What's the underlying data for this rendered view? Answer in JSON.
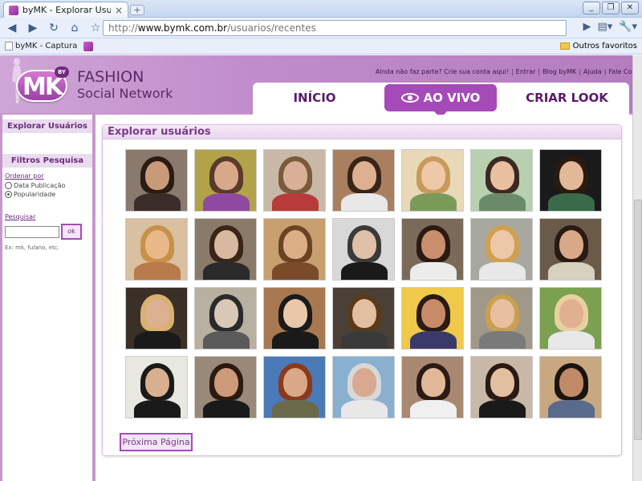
{
  "browser": {
    "tab_title": "byMK - Explorar Usuários",
    "tab_close": "×",
    "new_tab": "+",
    "window_buttons": [
      "_",
      "❐",
      "✕"
    ],
    "url_scheme": "http://",
    "url_host": "www.bymk.com.br",
    "url_path": "/usuarios/recentes",
    "bookmarks": [
      {
        "label": "byMK - Captura"
      }
    ],
    "other_bookmarks": "Outros favoritos"
  },
  "site": {
    "logo_text": "MK",
    "logo_badge": "BY",
    "brand_line1": "FASHION",
    "brand_line2": "Social Network",
    "top_links": [
      "Ainda não faz parte? Crie sua conta aqui!",
      "Entrar",
      "Blog byMK",
      "Ajuda",
      "Fale Conosco"
    ],
    "nav": [
      {
        "label": "INÍCIO",
        "active": false
      },
      {
        "label": "AO VIVO",
        "active": true
      },
      {
        "label": "CRIAR LOOK",
        "active": false
      }
    ]
  },
  "sidebar": {
    "explore_title": "Explorar Usuários",
    "filters_title": "Filtros Pesquisa",
    "order_label": "Ordenar por",
    "order_options": [
      {
        "label": "Data Publicação",
        "checked": false
      },
      {
        "label": "Popularidade",
        "checked": true
      }
    ],
    "search_label": "Pesquisar",
    "search_value": "",
    "search_button": "ok",
    "search_hint": "Ex: mk, fulano, etc."
  },
  "main": {
    "title": "Explorar usuários",
    "next_button": "Próxima Página",
    "users": [
      {
        "bg": "#8a7a6e",
        "skin": "#c99a7a",
        "hair": "#2a1b14",
        "body": "#3a2c28"
      },
      {
        "bg": "#b2a24a",
        "skin": "#d8a88a",
        "hair": "#5a3a2a",
        "body": "#8e4aa0"
      },
      {
        "bg": "#c8b8a8",
        "skin": "#d8b098",
        "hair": "#7a5a3a",
        "body": "#b83a3a"
      },
      {
        "bg": "#a88060",
        "skin": "#dcb090",
        "hair": "#3a2418",
        "body": "#e8e8e8"
      },
      {
        "bg": "#e8d8b8",
        "skin": "#eec8a8",
        "hair": "#c89a5a",
        "body": "#7a9a5a"
      },
      {
        "bg": "#b8d0b0",
        "skin": "#e8c0a0",
        "hair": "#3a2a22",
        "body": "#6a8a6a"
      },
      {
        "bg": "#1a1a1a",
        "skin": "#e2b898",
        "hair": "#2a1a10",
        "body": "#3a6a4a"
      },
      {
        "bg": "#d8c0a0",
        "skin": "#e8b888",
        "hair": "#c89048",
        "body": "#b87a4a"
      },
      {
        "bg": "#8a7a6a",
        "skin": "#d8b8a0",
        "hair": "#3a2418",
        "body": "#2a2a2a"
      },
      {
        "bg": "#c8a070",
        "skin": "#dcae88",
        "hair": "#6a4422",
        "body": "#7a4a2a"
      },
      {
        "bg": "#d8d8d8",
        "skin": "#e0c0a8",
        "hair": "#3a3a3a",
        "body": "#1a1a1a"
      },
      {
        "bg": "#7a6a5a",
        "skin": "#c88e6e",
        "hair": "#2a1a12",
        "body": "#ececec"
      },
      {
        "bg": "#a8a8a0",
        "skin": "#ecc8a8",
        "hair": "#d0a050",
        "body": "#e8e8e8"
      },
      {
        "bg": "#6a5a4a",
        "skin": "#d8a888",
        "hair": "#2a1a14",
        "body": "#d8d0c0"
      },
      {
        "bg": "#3a3026",
        "skin": "#dcb090",
        "hair": "#d8b070",
        "body": "#1a1a1a"
      },
      {
        "bg": "#b8b0a0",
        "skin": "#d8c8b8",
        "hair": "#2a2a2a",
        "body": "#5a5a5a"
      },
      {
        "bg": "#a87850",
        "skin": "#e8c8a8",
        "hair": "#1a1a1a",
        "body": "#1a1a1a"
      },
      {
        "bg": "#4a4038",
        "skin": "#e0c0a0",
        "hair": "#5a3a1a",
        "body": "#3a3a3a"
      },
      {
        "bg": "#f0c84a",
        "skin": "#c88a68",
        "hair": "#2a1a12",
        "body": "#3a3a6a"
      },
      {
        "bg": "#a09888",
        "skin": "#e8c0a0",
        "hair": "#c8a050",
        "body": "#7a7a7a"
      },
      {
        "bg": "#7aa050",
        "skin": "#e0b090",
        "hair": "#e8d0a0",
        "body": "#e8e8e8"
      },
      {
        "bg": "#e8e8e0",
        "skin": "#d8b090",
        "hair": "#1a1a1a",
        "body": "#1a1a1a"
      },
      {
        "bg": "#9a8878",
        "skin": "#cc9a78",
        "hair": "#2a1a12",
        "body": "#1a1a1a"
      },
      {
        "bg": "#4a7ab8",
        "skin": "#d8a888",
        "hair": "#8a3a1a",
        "body": "#6a6a4a"
      },
      {
        "bg": "#8ab0d0",
        "skin": "#d8a890",
        "hair": "#d8d8d8",
        "body": "#e8e8e8"
      },
      {
        "bg": "#a88870",
        "skin": "#e0b898",
        "hair": "#2a1a14",
        "body": "#f0f0f0"
      },
      {
        "bg": "#c8b8a8",
        "skin": "#e0c0a0",
        "hair": "#2a1a12",
        "body": "#1a1a1a"
      },
      {
        "bg": "#c8a880",
        "skin": "#c08a68",
        "hair": "#1a1410",
        "body": "#5a6a8a"
      }
    ]
  }
}
